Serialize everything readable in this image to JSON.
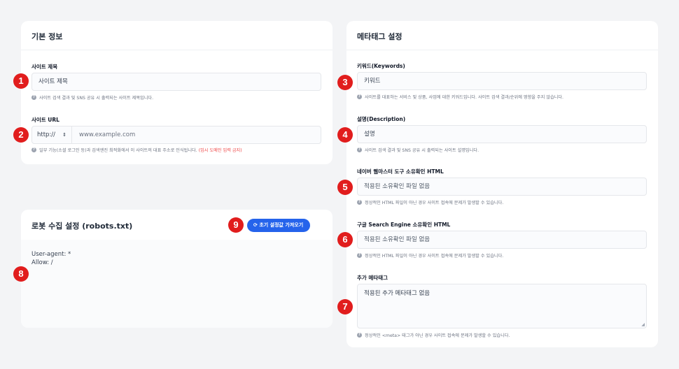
{
  "basic_info": {
    "title": "기본 정보",
    "site_title_label": "사이트 제목",
    "site_title_value": "사이트 제목",
    "site_title_help": "사이트 검색 결과 및 SNS 공유 시 출력되는 사이트 제목입니다.",
    "site_url_label": "사이트 URL",
    "protocol_value": "http://",
    "url_placeholder": "www.example.com",
    "site_url_help": "일부 기능(소셜 로그인 등)과 검색엔진 최적화에서 이 사이트의 대표 주소로 인식됩니다.",
    "site_url_warning": "(임시 도메인 입력 금지)"
  },
  "robots": {
    "title": "로봇 수집 설정 (robots.txt)",
    "reset_button": "초기 설정값 가져오기",
    "content": "User-agent: *\nAllow: /"
  },
  "meta_tags": {
    "title": "메타태그 설정",
    "keywords_label": "키워드(Keywords)",
    "keywords_value": "키워드",
    "keywords_help": "사이트를 대표하는 서비스 및 상품, 사업에 대한 키워드입니다. 사이트 검색 결과/순위에 영향을 주지 않습니다.",
    "description_label": "설명(Description)",
    "description_value": "설명",
    "description_help": "사이트 검색 결과 및 SNS 공유 시 출력되는 사이트 설명입니다.",
    "naver_label": "네이버 웹마스터 도구 소유확인 HTML",
    "naver_value": "적용된 소유확인 파일 없음",
    "naver_help": "정상적인 HTML 파일이 아닌 경우 사이트 접속에 문제가 발생할 수 있습니다.",
    "google_label": "구글 Search Engine 소유확인 HTML",
    "google_value": "적용된 소유확인 파일 없음",
    "google_help": "정상적인 HTML 파일이 아닌 경우 사이트 접속에 문제가 발생할 수 있습니다.",
    "extra_label": "추가 메타태그",
    "extra_value": "적용된 추가 메타태그 없음",
    "extra_help": "정상적인 <meta> 태그가 아닌 경우 사이트 접속에 문제가 발생할 수 있습니다."
  },
  "badges": [
    "1",
    "2",
    "3",
    "4",
    "5",
    "6",
    "7",
    "8",
    "9"
  ],
  "colors": {
    "badge": "#e11d1d",
    "primary": "#2563eb",
    "warning": "#ef4444"
  }
}
